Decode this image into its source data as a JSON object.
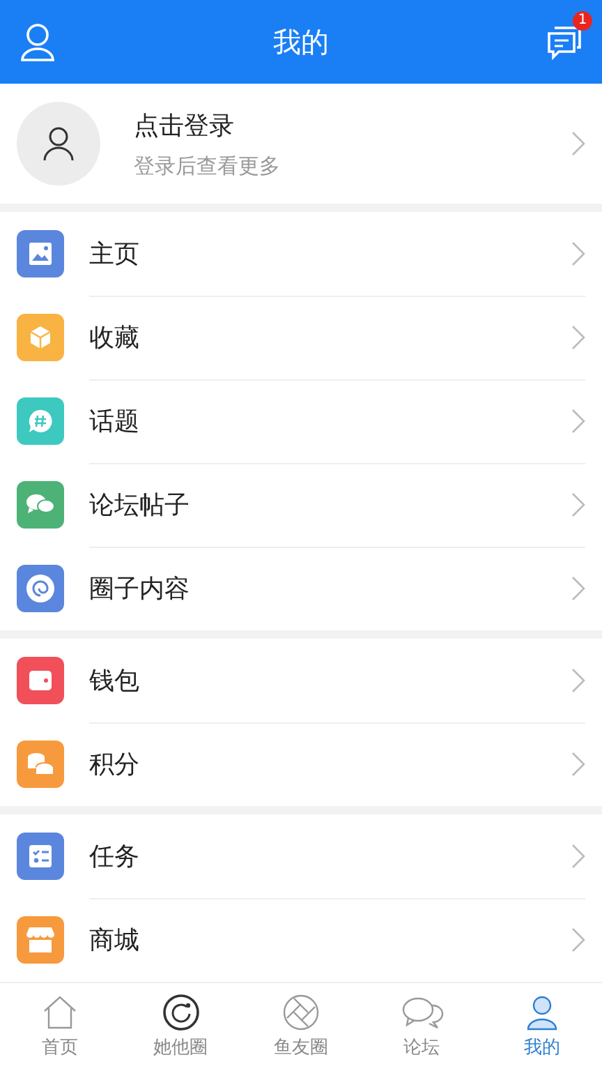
{
  "header": {
    "title": "我的",
    "badge": "1"
  },
  "profile": {
    "title": "点击登录",
    "subtitle": "登录后查看更多"
  },
  "sections": [
    [
      {
        "label": "主页",
        "kind": "image",
        "color": "#5b86dd"
      },
      {
        "label": "收藏",
        "kind": "box",
        "color": "#f9b343"
      },
      {
        "label": "话题",
        "kind": "hash",
        "color": "#3ec9c0"
      },
      {
        "label": "论坛帖子",
        "kind": "chat",
        "color": "#4db276"
      },
      {
        "label": "圈子内容",
        "kind": "swirl",
        "color": "#5b86dd"
      }
    ],
    [
      {
        "label": "钱包",
        "kind": "wallet",
        "color": "#f1505a"
      },
      {
        "label": "积分",
        "kind": "coins",
        "color": "#f79a3e"
      }
    ],
    [
      {
        "label": "任务",
        "kind": "tasks",
        "color": "#5b86dd"
      },
      {
        "label": "商城",
        "kind": "shop",
        "color": "#f79a3e"
      }
    ]
  ],
  "tabs": [
    {
      "label": "首页",
      "kind": "home",
      "selected": false
    },
    {
      "label": "她他圈",
      "kind": "ring",
      "selected": false
    },
    {
      "label": "鱼友圈",
      "kind": "aperture",
      "selected": false
    },
    {
      "label": "论坛",
      "kind": "chat",
      "selected": false
    },
    {
      "label": "我的",
      "kind": "user",
      "selected": true
    }
  ]
}
